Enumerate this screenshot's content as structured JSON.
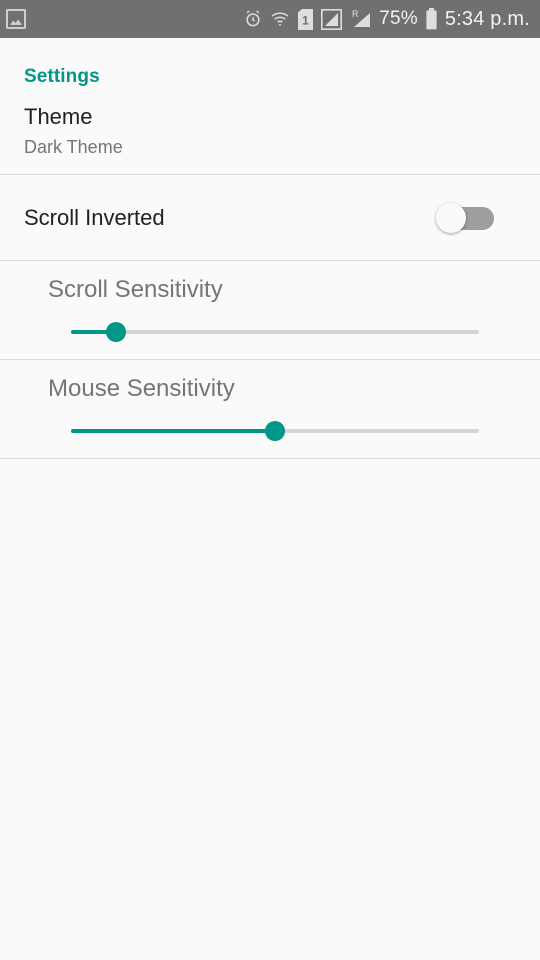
{
  "status_bar": {
    "background": "#707070",
    "left_icons": [
      {
        "name": "image-notification-icon",
        "glyph": "image"
      }
    ],
    "right_icons": [
      {
        "name": "alarm-icon",
        "glyph": "alarm"
      },
      {
        "name": "wifi-icon",
        "glyph": "wifi"
      },
      {
        "name": "sim-one-icon",
        "label": "1"
      },
      {
        "name": "signal-bars-icon",
        "glyph": "signal"
      },
      {
        "name": "roaming-signal-icon",
        "label": "R"
      }
    ],
    "battery_percent": "75%",
    "battery_icon": "battery-full-icon",
    "time": "5:34 p.m."
  },
  "settings": {
    "header": "Settings",
    "accent_color": "#009688",
    "rows": {
      "theme": {
        "title": "Theme",
        "subtitle": "Dark Theme"
      },
      "scroll_inverted": {
        "title": "Scroll Inverted",
        "toggle_state": "off"
      },
      "scroll_sensitivity": {
        "label": "Scroll Sensitivity",
        "value_percent": 11
      },
      "mouse_sensitivity": {
        "label": "Mouse Sensitivity",
        "value_percent": 50
      }
    }
  }
}
